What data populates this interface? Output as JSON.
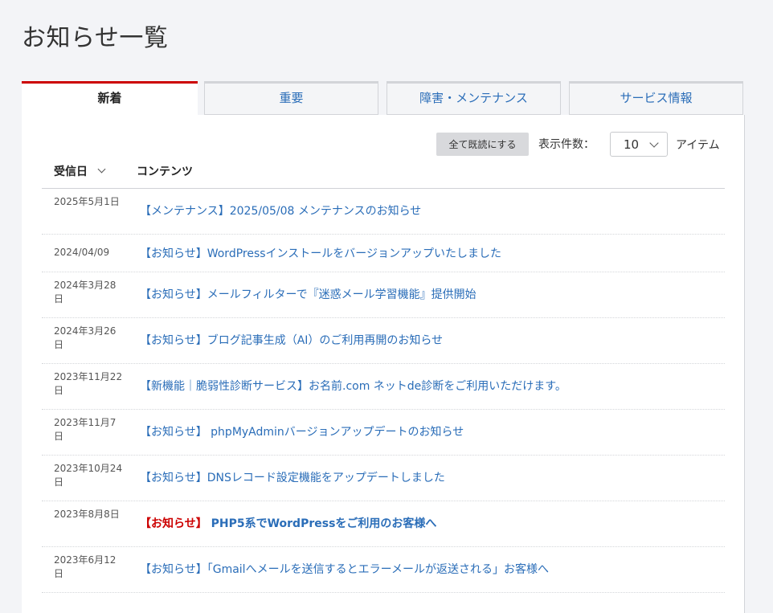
{
  "page": {
    "title": "お知らせ一覧"
  },
  "tabs": [
    {
      "label": "新着",
      "active": true
    },
    {
      "label": "重要",
      "active": false
    },
    {
      "label": "障害・メンテナンス",
      "active": false
    },
    {
      "label": "サービス情報",
      "active": false
    }
  ],
  "toolbar": {
    "mark_all_read_label": "全て既読にする",
    "per_page_label": "表示件数：",
    "per_page_value": "10",
    "items_label": "アイテム"
  },
  "table": {
    "header_date": "受信日",
    "header_content": "コンテンツ",
    "rows": [
      {
        "date": "2025年5月1日",
        "title": "【メンテナンス】2025/05/08 メンテナンスのお知らせ"
      },
      {
        "date": "2024/04/09",
        "title": "【お知らせ】WordPressインストールをバージョンアップいたしました"
      },
      {
        "date": "2024年3月28日",
        "title": "【お知らせ】メールフィルターで『迷惑メール学習機能』提供開始"
      },
      {
        "date": "2024年3月26日",
        "title": "【お知らせ】ブログ記事生成（AI）のご利用再開のお知らせ"
      },
      {
        "date": "2023年11月22日",
        "title": "【新機能｜脆弱性診断サービス】お名前.com ネットde診断をご利用いただけます。"
      },
      {
        "date": "2023年11月7日",
        "title": "【お知らせ】 phpMyAdminバージョンアップデートのお知らせ"
      },
      {
        "date": "2023年10月24日",
        "title": "【お知らせ】DNSレコード設定機能をアップデートしました"
      },
      {
        "date": "2023年8月8日",
        "tag": "【お知らせ】",
        "title": " PHP5系でWordPressをご利用のお客様へ"
      },
      {
        "date": "2023年6月12日",
        "title": "【お知らせ】「Gmailへメールを送信するとエラーメールが返送される」お客様へ"
      }
    ]
  },
  "colors": {
    "accent_red": "#cc0000",
    "link_blue": "#2a6db8",
    "background": "#f3f4f7"
  },
  "icons": {
    "sort": "chevron-down-icon",
    "select": "chevron-down-icon"
  }
}
